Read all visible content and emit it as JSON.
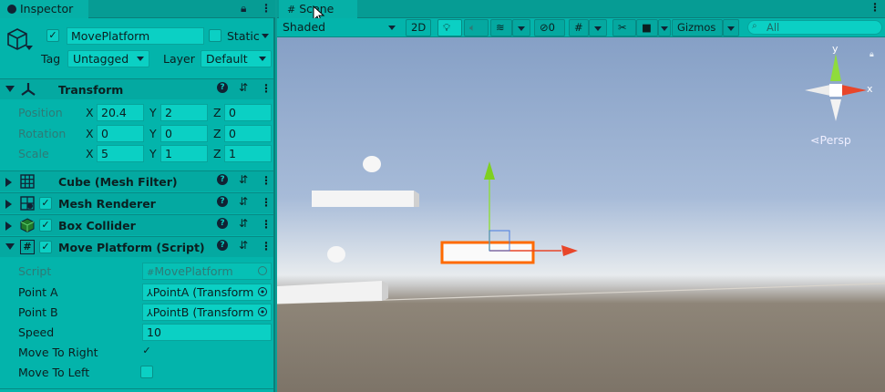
{
  "inspector": {
    "tab_label": "Inspector",
    "object_name": "MovePlatform",
    "static_label": "Static",
    "tag_label": "Tag",
    "tag_value": "Untagged",
    "layer_label": "Layer",
    "layer_value": "Default",
    "transform": {
      "title": "Transform",
      "rows": [
        {
          "label": "Position",
          "x": "20.4",
          "y": "2",
          "z": "0"
        },
        {
          "label": "Rotation",
          "x": "0",
          "y": "0",
          "z": "0"
        },
        {
          "label": "Scale",
          "x": "5",
          "y": "1",
          "z": "1"
        }
      ],
      "axis_x": "X",
      "axis_y": "Y",
      "axis_z": "Z"
    },
    "components": [
      {
        "title": "Cube (Mesh Filter)"
      },
      {
        "title": "Mesh Renderer"
      },
      {
        "title": "Box Collider"
      },
      {
        "title": "Move Platform (Script)"
      }
    ],
    "script": {
      "script_label": "Script",
      "script_value": "MovePlatform",
      "point_a_label": "Point A",
      "point_a_value": "PointA (Transform",
      "point_b_label": "Point B",
      "point_b_value": "PointB (Transform",
      "speed_label": "Speed",
      "speed_value": "10",
      "move_right_label": "Move To Right",
      "move_right_checked": "✓",
      "move_left_label": "Move To Left"
    }
  },
  "scene": {
    "tab_label": "Scene",
    "shading_mode": "Shaded",
    "mode_2d": "2D",
    "hidden_count": "0",
    "gizmos_label": "Gizmos",
    "search_placeholder": "All",
    "gizmo_y": "y",
    "gizmo_x": "x",
    "persp_label": "Persp"
  },
  "colors": {
    "accent": "#03b4ab",
    "selection_outline": "#ff6a00"
  }
}
